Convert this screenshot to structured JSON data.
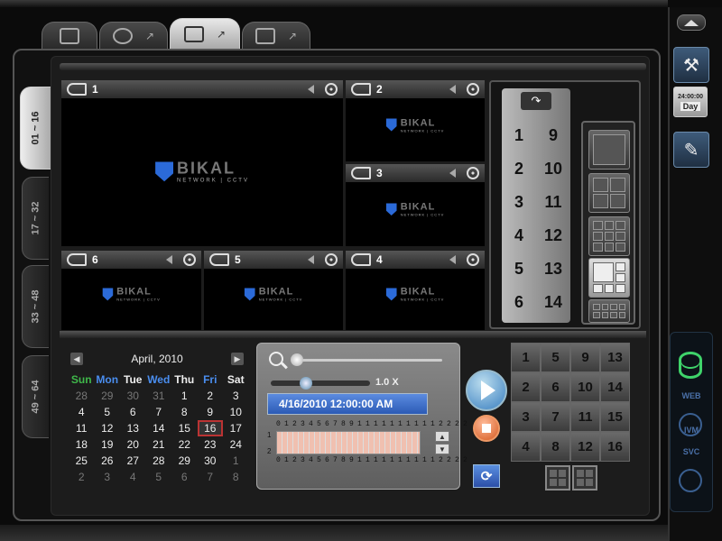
{
  "cameras": [
    {
      "label": "1"
    },
    {
      "label": "2"
    },
    {
      "label": "3"
    },
    {
      "label": "6"
    },
    {
      "label": "5"
    },
    {
      "label": "4"
    }
  ],
  "logo": {
    "brand": "BIKAL",
    "tagline": "NETWORK | CCTV"
  },
  "vertical_tabs": [
    "01 ~ 16",
    "17 ~ 32",
    "33 ~ 48",
    "49 ~ 64"
  ],
  "channel_column": [
    "1",
    "9",
    "2",
    "10",
    "3",
    "11",
    "4",
    "12",
    "5",
    "13",
    "6",
    "14"
  ],
  "calendar": {
    "month": "April, 2010",
    "days_header": [
      "Sun",
      "Mon",
      "Tue",
      "Wed",
      "Thu",
      "Fri",
      "Sat"
    ],
    "header_colors": [
      "#3fb84a",
      "#4a8ef0",
      "#eeeeee",
      "#4a8ef0",
      "#eeeeee",
      "#4a8ef0",
      "#eeeeee"
    ],
    "selected": "16",
    "weeks": [
      [
        "28",
        "29",
        "30",
        "31",
        "1",
        "2",
        "3"
      ],
      [
        "4",
        "5",
        "6",
        "7",
        "8",
        "9",
        "10"
      ],
      [
        "11",
        "12",
        "13",
        "14",
        "15",
        "16",
        "17"
      ],
      [
        "18",
        "19",
        "20",
        "21",
        "22",
        "23",
        "24"
      ],
      [
        "25",
        "26",
        "27",
        "28",
        "29",
        "30",
        "1"
      ],
      [
        "2",
        "3",
        "4",
        "5",
        "6",
        "7",
        "8"
      ]
    ],
    "dim_mask": [
      [
        1,
        1,
        1,
        1,
        0,
        0,
        0
      ],
      [
        0,
        0,
        0,
        0,
        0,
        0,
        0
      ],
      [
        0,
        0,
        0,
        0,
        0,
        0,
        0
      ],
      [
        0,
        0,
        0,
        0,
        0,
        0,
        0
      ],
      [
        0,
        0,
        0,
        0,
        0,
        0,
        1
      ],
      [
        1,
        1,
        1,
        1,
        1,
        1,
        1
      ]
    ]
  },
  "playback": {
    "speed": "1.0 X",
    "datetime": "4/16/2010 12:00:00 AM",
    "timeline_hours": "0 1 2 3 4 5 6 7 8 9 1 1 1 1 1 1 1 1 1 1 2 2 2 2",
    "row_labels": [
      "1",
      "2"
    ],
    "speed_position_pct": 35,
    "zoom_position_pct": 0
  },
  "channel_grid": [
    "1",
    "5",
    "9",
    "13",
    "2",
    "6",
    "10",
    "14",
    "3",
    "7",
    "11",
    "15",
    "4",
    "8",
    "12",
    "16"
  ],
  "sidebar": {
    "clock_time": "24:00:00",
    "clock_mode": "Day",
    "web": "WEB",
    "ivm": "IVM",
    "svc": "SVC"
  }
}
